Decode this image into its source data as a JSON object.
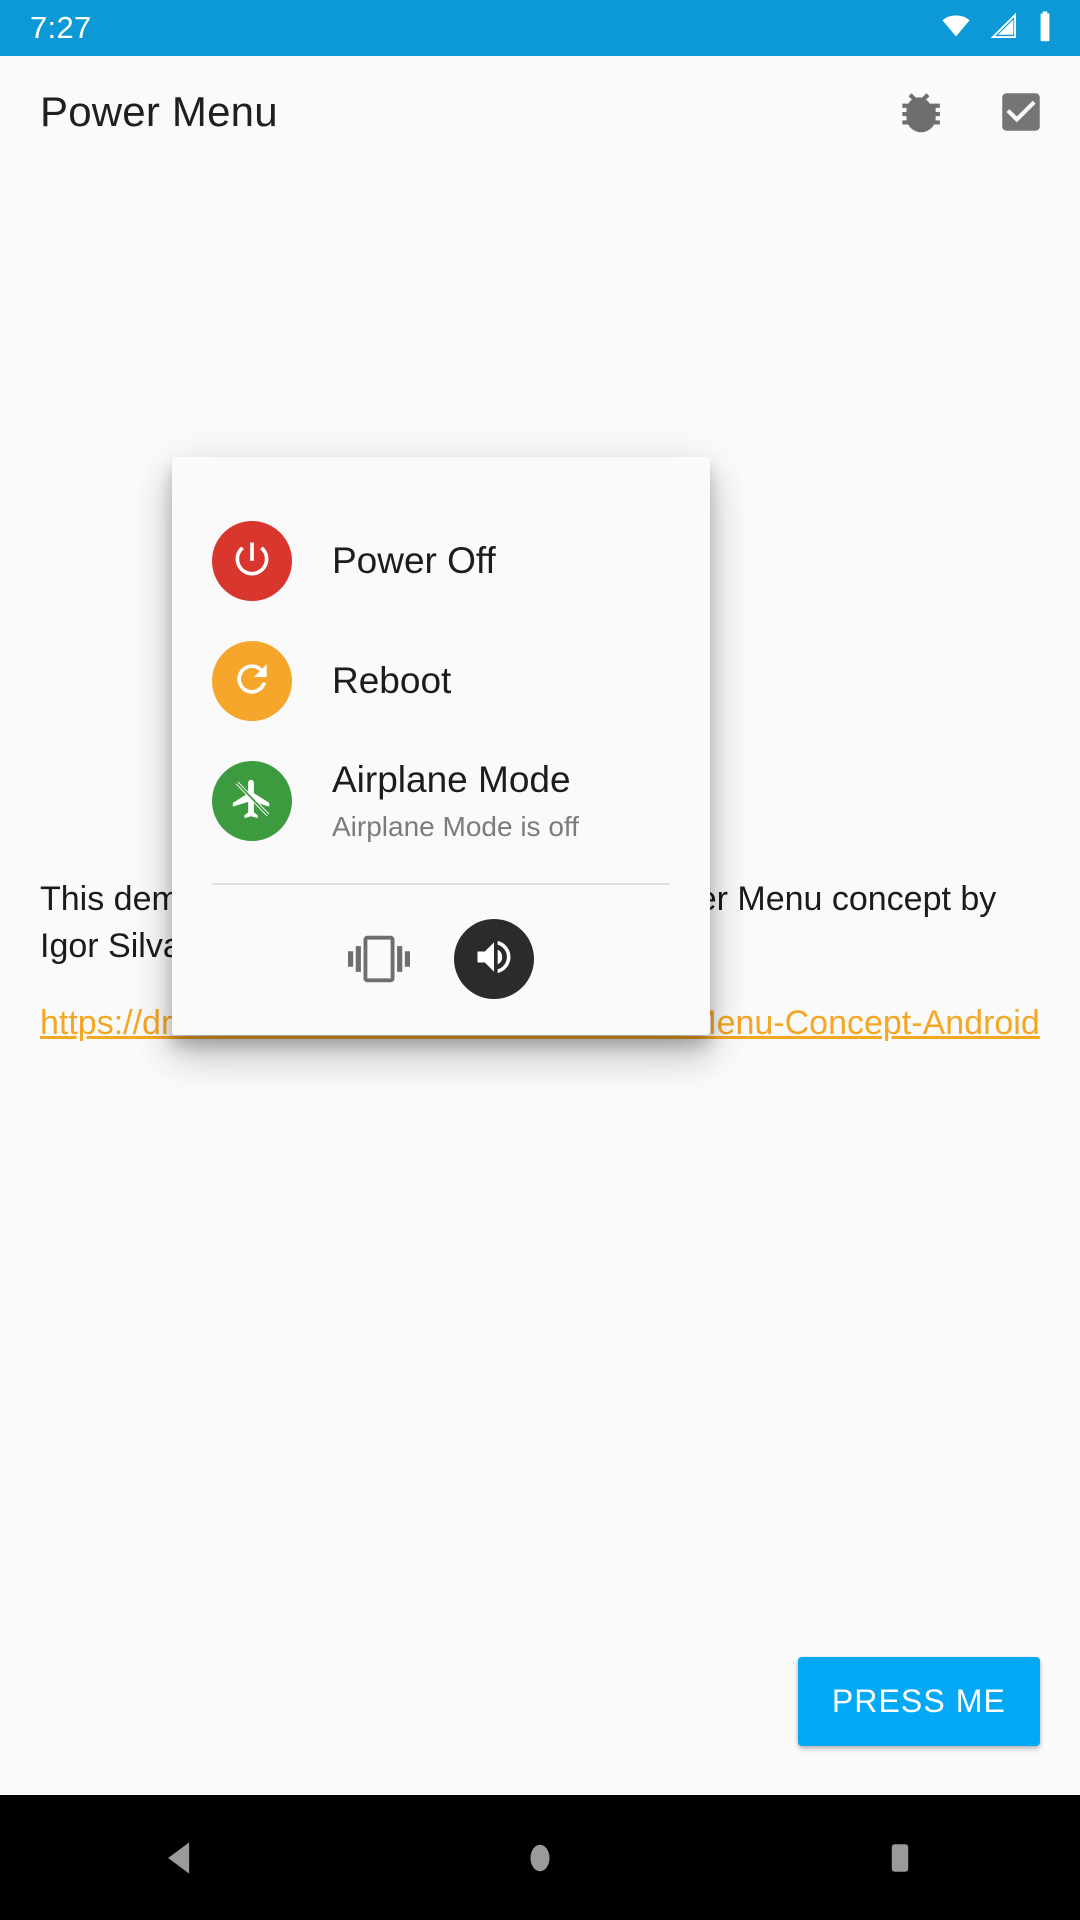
{
  "status_bar": {
    "time": "7:27",
    "background": "#0d99d6",
    "icons": [
      "wifi-icon",
      "cellular-signal-icon",
      "battery-icon"
    ]
  },
  "app_bar": {
    "title": "Power Menu",
    "actions": [
      {
        "name": "bug-report-icon",
        "label": "Bug report"
      },
      {
        "name": "checkbox-checked-icon",
        "label": "Checkbox"
      }
    ]
  },
  "background": {
    "paragraph": "This demo is inspired by the Advanced Power Menu concept by Igor Silva.",
    "link": "https://dribbble.com/shots/3767715-Power-Menu-Concept-Android",
    "link_color": "#f5a623"
  },
  "press_me_button": {
    "label": "PRESS ME",
    "color": "#03a9f4"
  },
  "dialog": {
    "rows": [
      {
        "id": "power-off",
        "title": "Power Off",
        "subtitle": "",
        "icon": "power-icon",
        "circle_color": "#d9362e"
      },
      {
        "id": "reboot",
        "title": "Reboot",
        "subtitle": "",
        "icon": "refresh-icon",
        "circle_color": "#f5a62b"
      },
      {
        "id": "airplane-mode",
        "title": "Airplane Mode",
        "subtitle": "Airplane Mode is off",
        "icon": "airplane-off-icon",
        "circle_color": "#3c9a3f"
      }
    ],
    "sound_controls": [
      {
        "id": "vibrate",
        "icon": "vibration-icon",
        "selected": false,
        "color": "#6e6e6e"
      },
      {
        "id": "volume",
        "icon": "volume-up-icon",
        "selected": true,
        "color": "#2b2b2b"
      }
    ]
  },
  "nav_bar": {
    "buttons": [
      {
        "name": "back-icon",
        "label": "Back"
      },
      {
        "name": "home-icon",
        "label": "Home"
      },
      {
        "name": "recents-icon",
        "label": "Recents"
      }
    ],
    "icon_color": "#9a9a9a"
  }
}
